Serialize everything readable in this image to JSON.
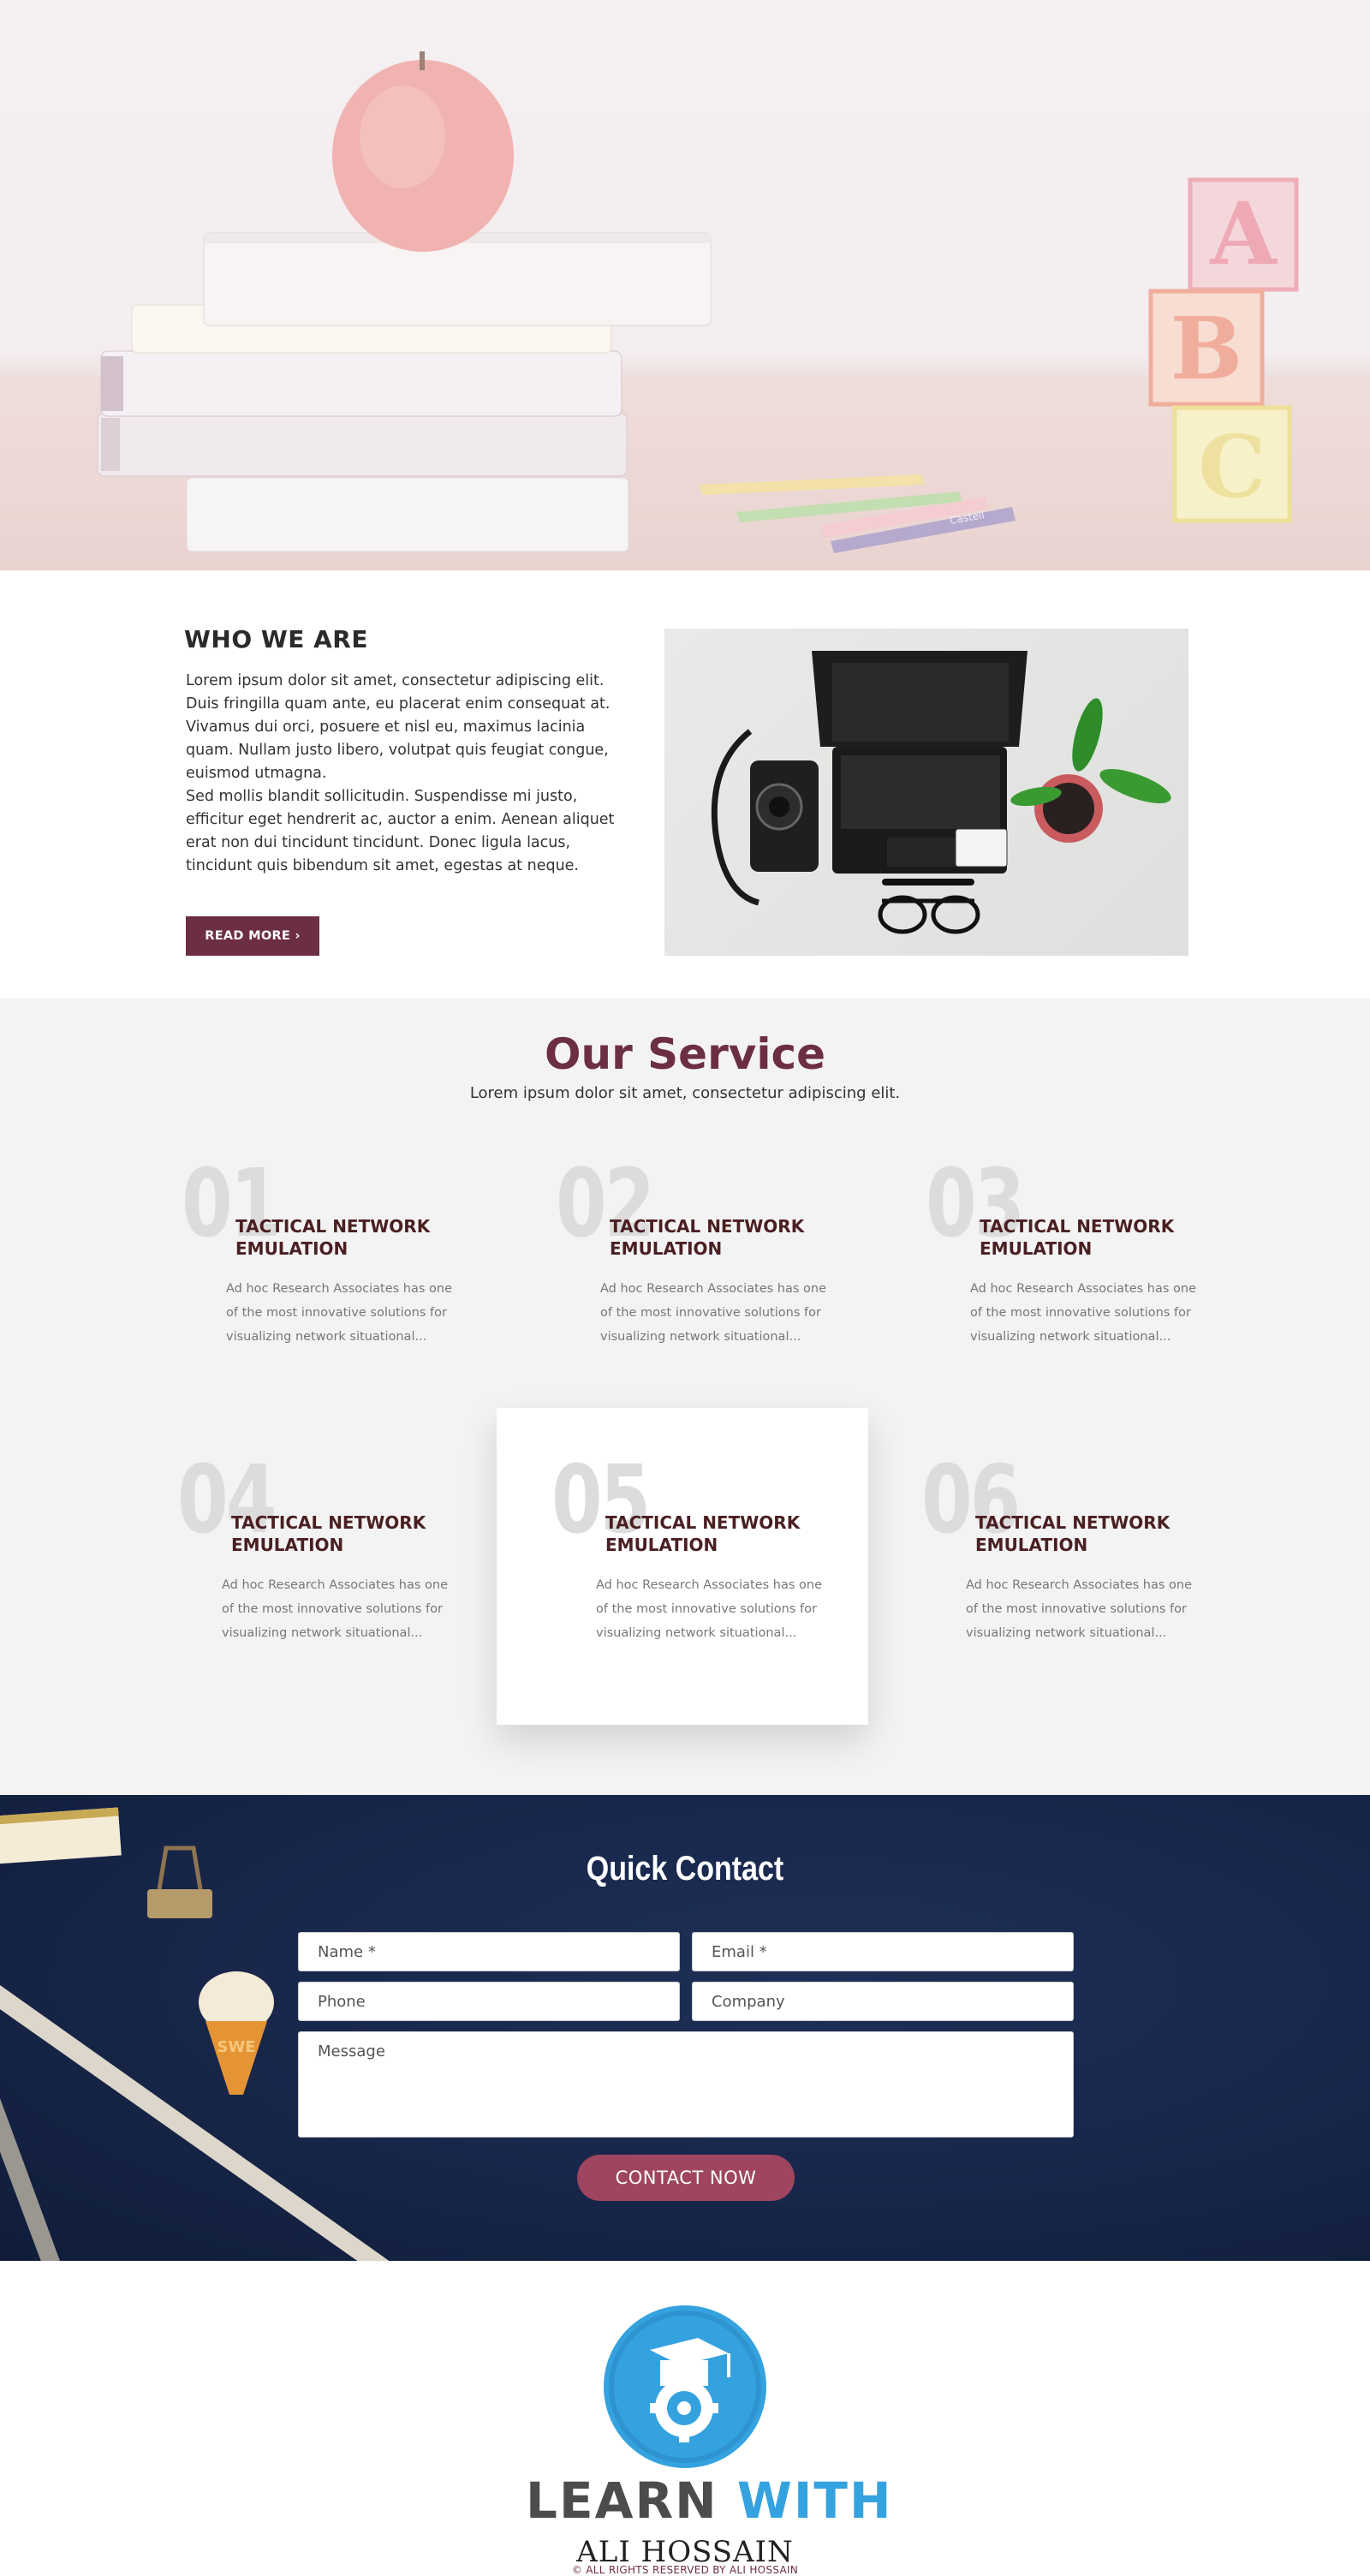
{
  "hero": {
    "blocks": [
      "A",
      "B",
      "C"
    ],
    "pencil_brand": "Castell"
  },
  "about": {
    "title": "WHO WE ARE",
    "paragraph1": "Lorem ipsum dolor sit amet, consectetur adipiscing elit. Duis fringilla quam ante, eu placerat enim consequat at. Vivamus dui orci, posuere et nisl eu, maximus lacinia quam. Nullam justo libero, volutpat quis feugiat congue, euismod utmagna.",
    "paragraph2": "Sed mollis blandit sollicitudin. Suspendisse mi justo, efficitur eget hendrerit ac, auctor a enim. Aenean aliquet erat non dui tincidunt tincidunt. Donec ligula lacus, tincidunt quis bibendum sit amet, egestas at neque.",
    "button": "READ MORE ›"
  },
  "services": {
    "title": "Our Service",
    "subtitle": "Lorem ipsum dolor sit amet, consectetur adipiscing elit.",
    "items": [
      {
        "num": "01",
        "title": "TACTICAL NETWORK EMULATION",
        "text": "Ad hoc Research Associates has one of the most innovative solutions for visualizing network situational..."
      },
      {
        "num": "02",
        "title": "TACTICAL NETWORK EMULATION",
        "text": "Ad hoc Research Associates has one of the most innovative solutions for visualizing network situational..."
      },
      {
        "num": "03",
        "title": "TACTICAL NETWORK EMULATION",
        "text": "Ad hoc Research Associates has one of the most innovative solutions for visualizing network situational..."
      },
      {
        "num": "04",
        "title": "TACTICAL NETWORK EMULATION",
        "text": "Ad hoc Research Associates has one of the most innovative solutions for visualizing network situational..."
      },
      {
        "num": "05",
        "title": "TACTICAL NETWORK EMULATION",
        "text": "Ad hoc Research Associates has one of the most innovative solutions for visualizing network situational..."
      },
      {
        "num": "06",
        "title": "TACTICAL NETWORK EMULATION",
        "text": "Ad hoc Research Associates has one of the most innovative solutions for visualizing network situational..."
      }
    ]
  },
  "contact": {
    "title": "Quick Contact",
    "name_placeholder": "Name *",
    "email_placeholder": "Email *",
    "phone_placeholder": "Phone",
    "company_placeholder": "Company",
    "message_placeholder": "Message",
    "button": "CONTACT NOW",
    "cone_text": "SWE"
  },
  "footer": {
    "logo_word1": "LEARN",
    "logo_word2": "WITH",
    "logo_name": "ALI HOSSAIN",
    "copyright": "© ALL RIGHTS RESERVED BY ALI HOSSAIN"
  },
  "colors": {
    "brand": "#6c2e43",
    "button_contact": "#a0455f",
    "contact_bg": "#172649",
    "logo_blue": "#35a2e0"
  }
}
